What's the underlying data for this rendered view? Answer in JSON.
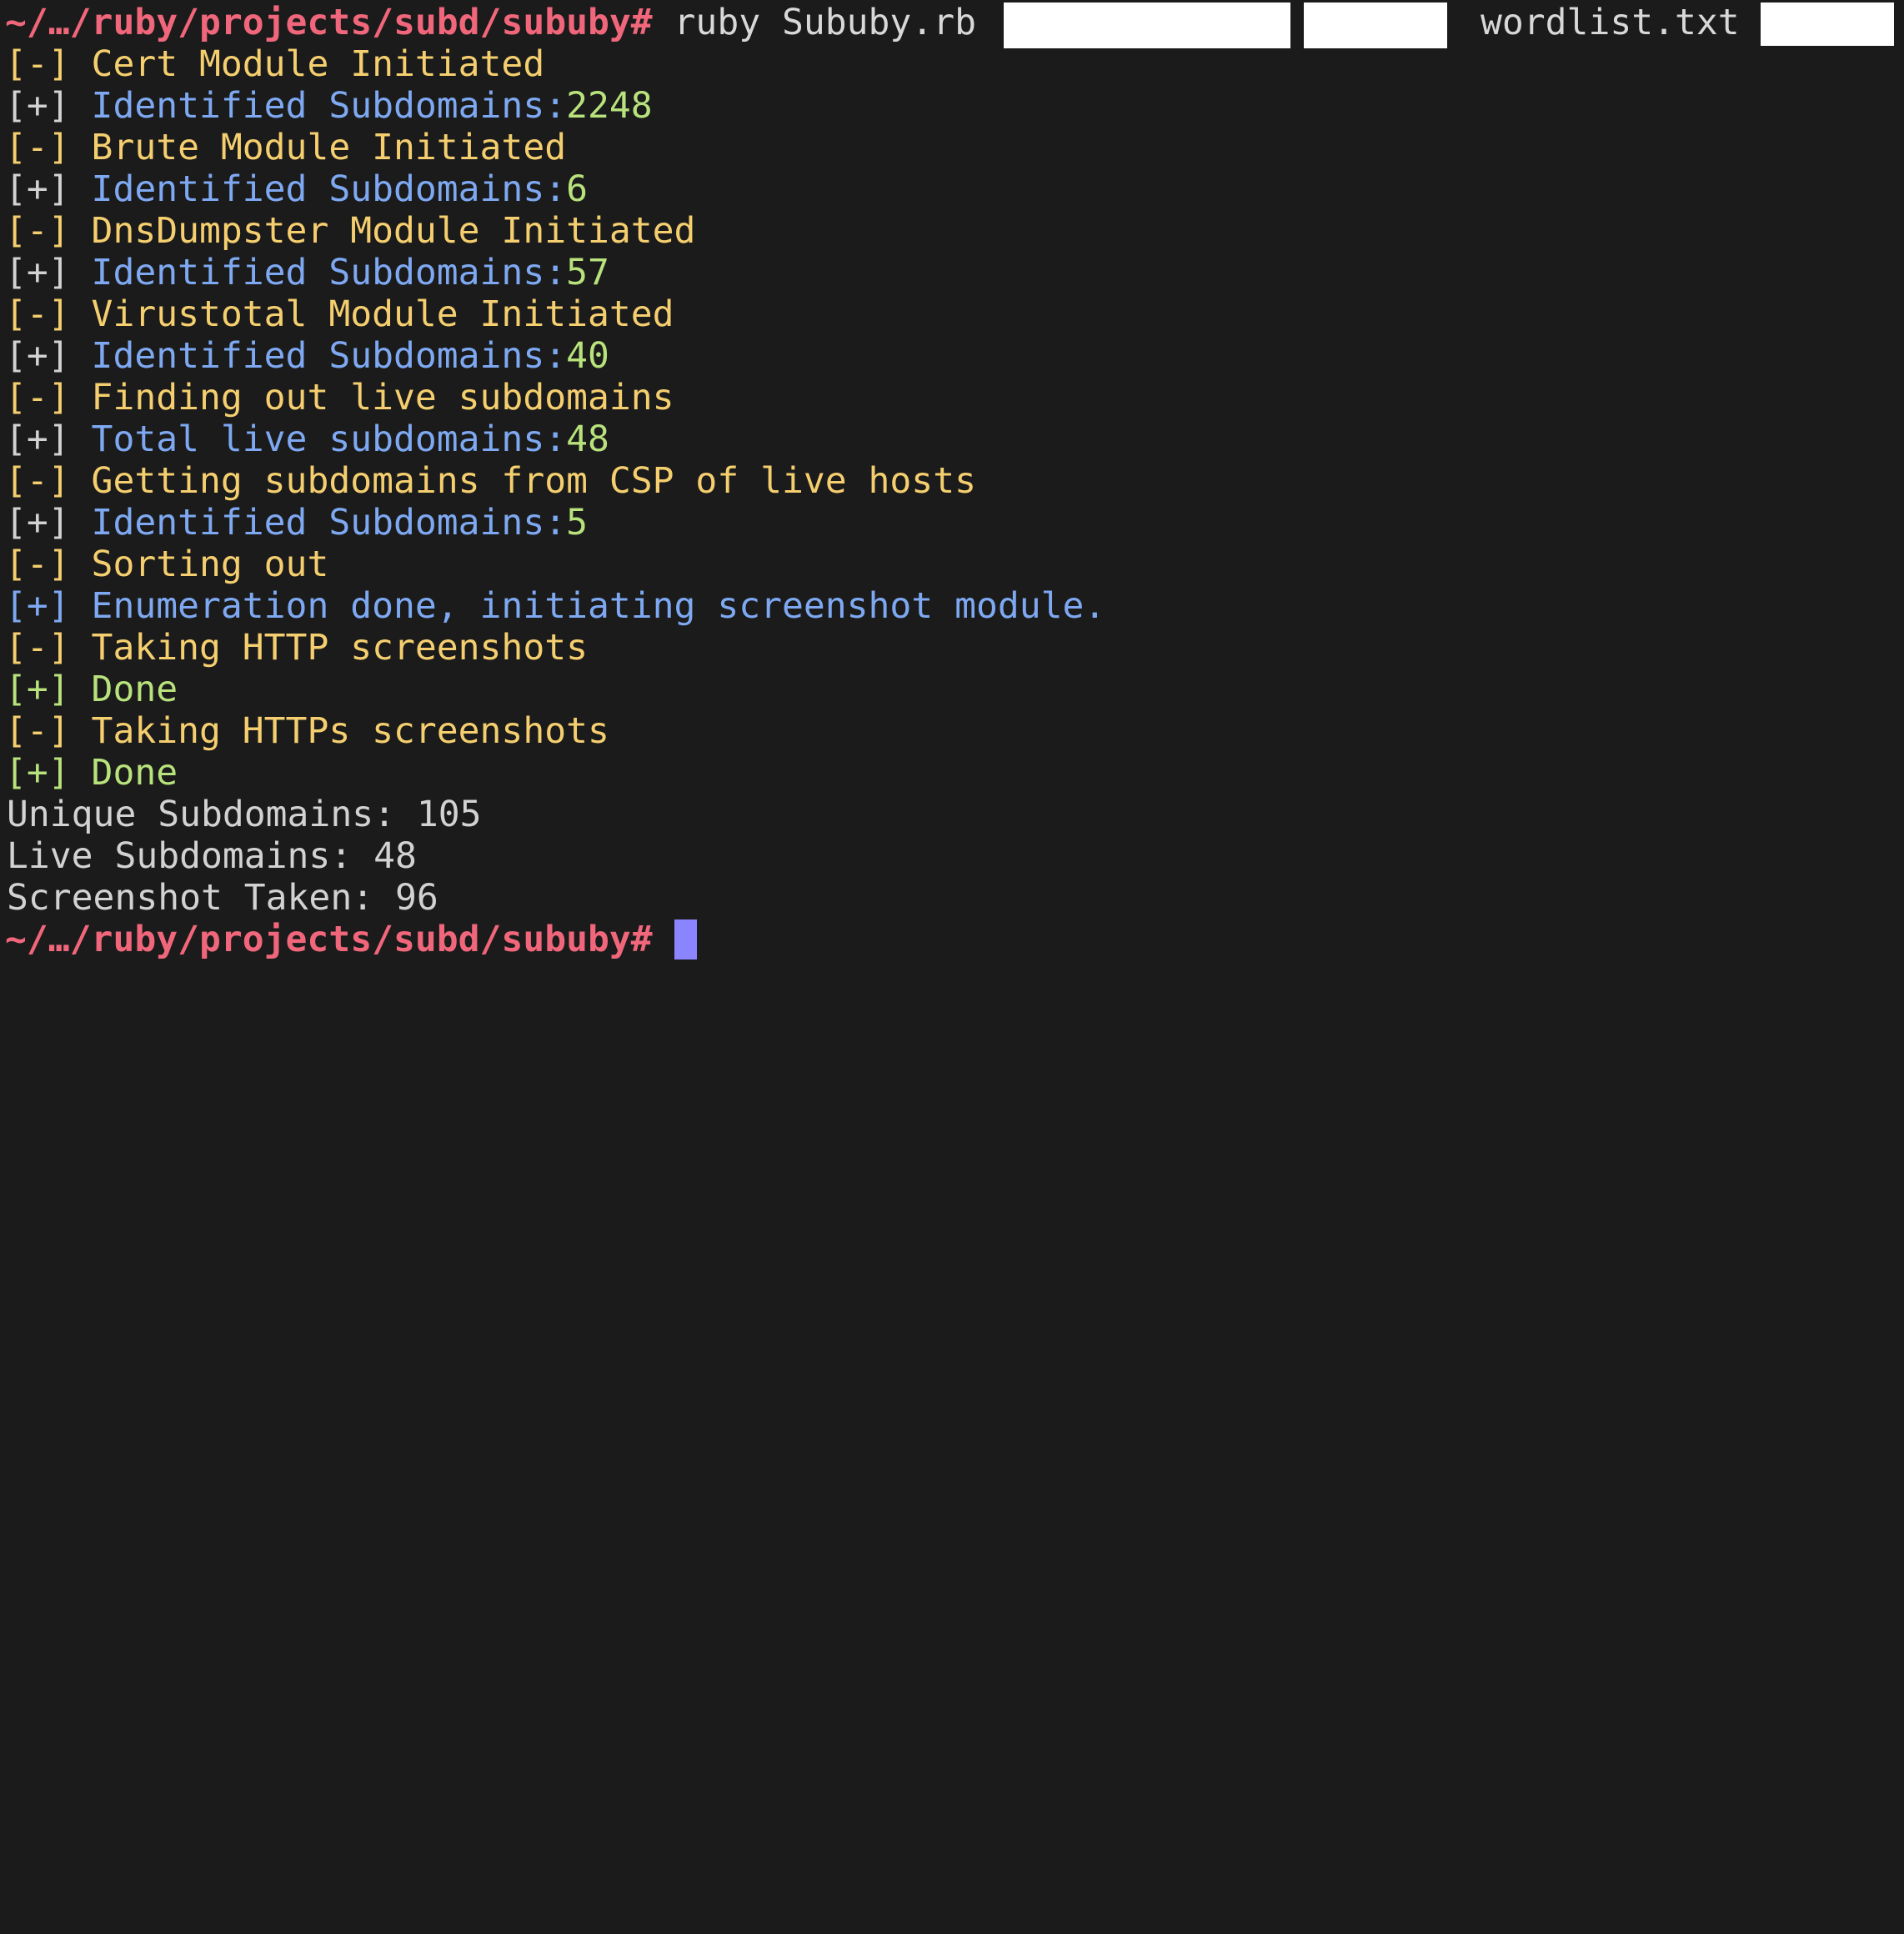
{
  "prompt": {
    "path": "~/…/ruby/projects/subd/sububy",
    "symbol": "#"
  },
  "command": {
    "text": " ruby Sububy.rb",
    "arg": "wordlist.txt"
  },
  "lines": [
    {
      "bracket": "[-]",
      "text": " Cert Module Initiated",
      "value": ""
    },
    {
      "bracket": "[+]",
      "text": " Identified Subdomains:",
      "value": "2248"
    },
    {
      "bracket": "[-]",
      "text": " Brute Module Initiated",
      "value": ""
    },
    {
      "bracket": "[+]",
      "text": " Identified Subdomains:",
      "value": "6"
    },
    {
      "bracket": "[-]",
      "text": " DnsDumpster Module Initiated",
      "value": ""
    },
    {
      "bracket": "[+]",
      "text": " Identified Subdomains:",
      "value": "57"
    },
    {
      "bracket": "[-]",
      "text": " Virustotal Module Initiated",
      "value": ""
    },
    {
      "bracket": "[+]",
      "text": " Identified Subdomains:",
      "value": "40"
    },
    {
      "bracket": "[-]",
      "text": " Finding out live subdomains",
      "value": ""
    },
    {
      "bracket": "[+]",
      "text": " Total live subdomains:",
      "value": "48"
    },
    {
      "bracket": "[-]",
      "text": " Getting subdomains from CSP of live hosts",
      "value": ""
    },
    {
      "bracket": "[+]",
      "text": " Identified Subdomains:",
      "value": "5"
    },
    {
      "bracket": "[-]",
      "text": " Sorting out",
      "value": ""
    },
    {
      "bracket": "[+]",
      "text": " Enumeration done, initiating screenshot module.",
      "value": ""
    },
    {
      "bracket": "[-]",
      "text": " Taking HTTP screenshots",
      "value": ""
    },
    {
      "bracket": "[+]",
      "text": " Done",
      "value": ""
    },
    {
      "bracket": "[-]",
      "text": " Taking HTTPs screenshots",
      "value": ""
    },
    {
      "bracket": "[+]",
      "text": " Done",
      "value": ""
    }
  ],
  "summary": [
    "Unique Subdomains: 105",
    "Live Subdomains: 48",
    "Screenshot Taken: 96"
  ],
  "colors": {
    "background": "#1b1b1b",
    "prompt": "#f0667a",
    "status_dash": "#f5cf6f",
    "status_plus": "#7ea9f2",
    "numbers": "#b8e27c",
    "cursor": "#8a85ff"
  }
}
